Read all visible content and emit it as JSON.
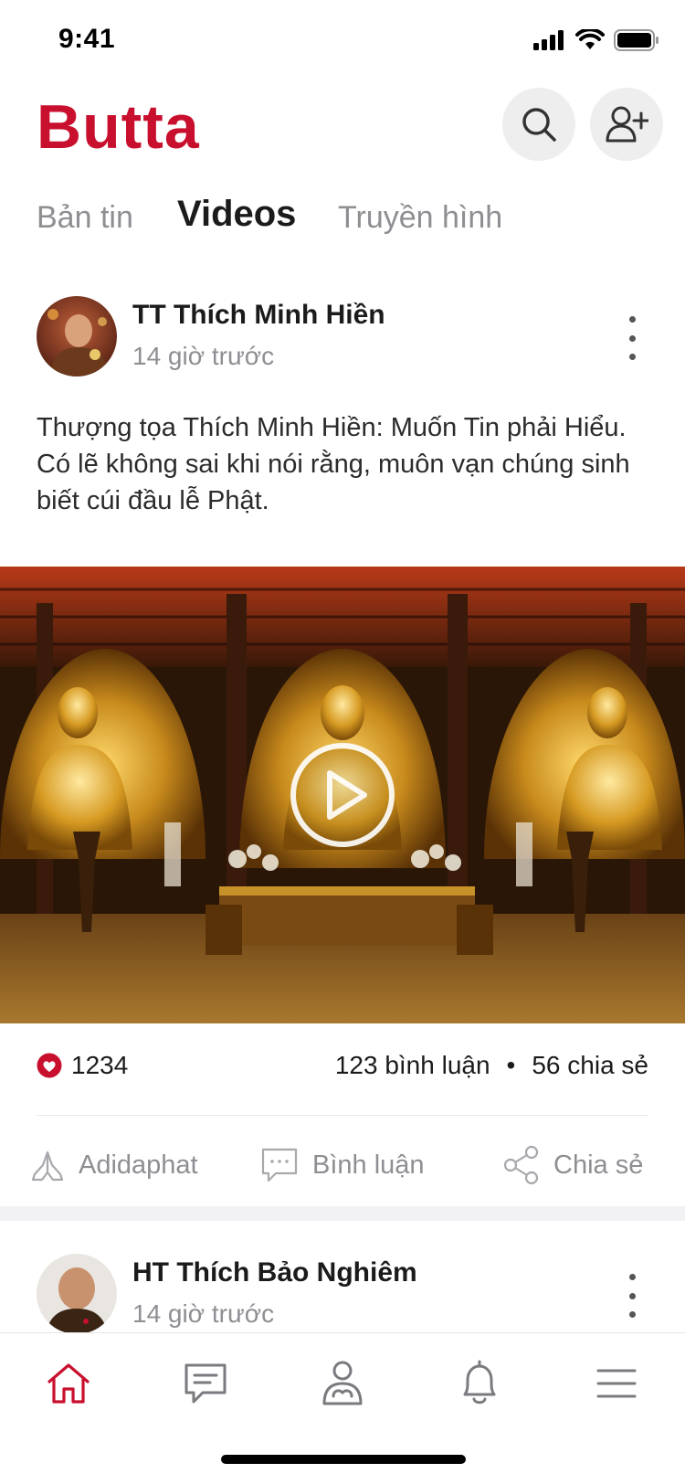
{
  "status_bar": {
    "time": "9:41"
  },
  "header": {
    "brand": "Butta"
  },
  "tabs": [
    {
      "label": "Bản tin",
      "active": false
    },
    {
      "label": "Videos",
      "active": true
    },
    {
      "label": "Truyền hình",
      "active": false
    }
  ],
  "posts": [
    {
      "author": "TT Thích Minh Hiền",
      "time": "14 giờ trước",
      "caption": "Thượng tọa Thích Minh Hiền: Muốn Tin phải Hiểu. Có lẽ không sai khi nói rằng, muôn vạn chúng sinh biết cúi đầu lễ Phật.",
      "likes": "1234",
      "comments": "123 bình luận",
      "separator": "•",
      "shares": "56 chia sẻ"
    },
    {
      "author": "HT Thích Bảo Nghiêm",
      "time": "14 giờ trước"
    }
  ],
  "actions": {
    "pray": "Adidaphat",
    "comment": "Bình luận",
    "share": "Chia sẻ"
  },
  "icons": {
    "search": "search-icon",
    "add_user": "add-user-icon",
    "more": "more-vertical-icon",
    "heart": "heart-icon",
    "play": "play-icon",
    "pray": "praying-hands-icon",
    "comment": "comment-icon",
    "share": "share-icon",
    "home": "home-icon",
    "messages": "message-icon",
    "profile": "monk-profile-icon",
    "notifications": "bell-icon",
    "menu": "menu-icon"
  },
  "colors": {
    "brand": "#c8102e",
    "muted": "#8e8e93",
    "text": "#1b1b1b"
  }
}
